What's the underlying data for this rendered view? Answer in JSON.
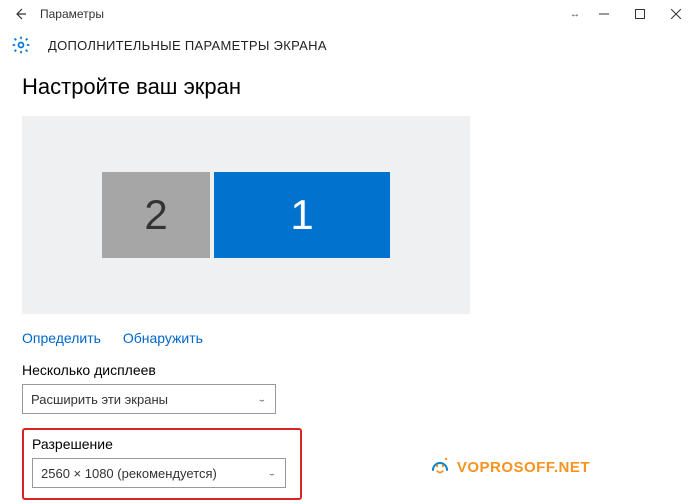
{
  "titlebar": {
    "title": "Параметры"
  },
  "subheader": {
    "title": "ДОПОЛНИТЕЛЬНЫЕ ПАРАМЕТРЫ ЭКРАНА"
  },
  "heading": "Настройте ваш экран",
  "monitors": {
    "primary_label": "1",
    "secondary_label": "2"
  },
  "links": {
    "identify": "Определить",
    "detect": "Обнаружить"
  },
  "multiple_displays": {
    "label": "Несколько дисплеев",
    "selected": "Расширить эти экраны"
  },
  "resolution": {
    "label": "Разрешение",
    "selected": "2560 × 1080 (рекомендуется)"
  },
  "watermark": "VOPROSOFF.NET"
}
